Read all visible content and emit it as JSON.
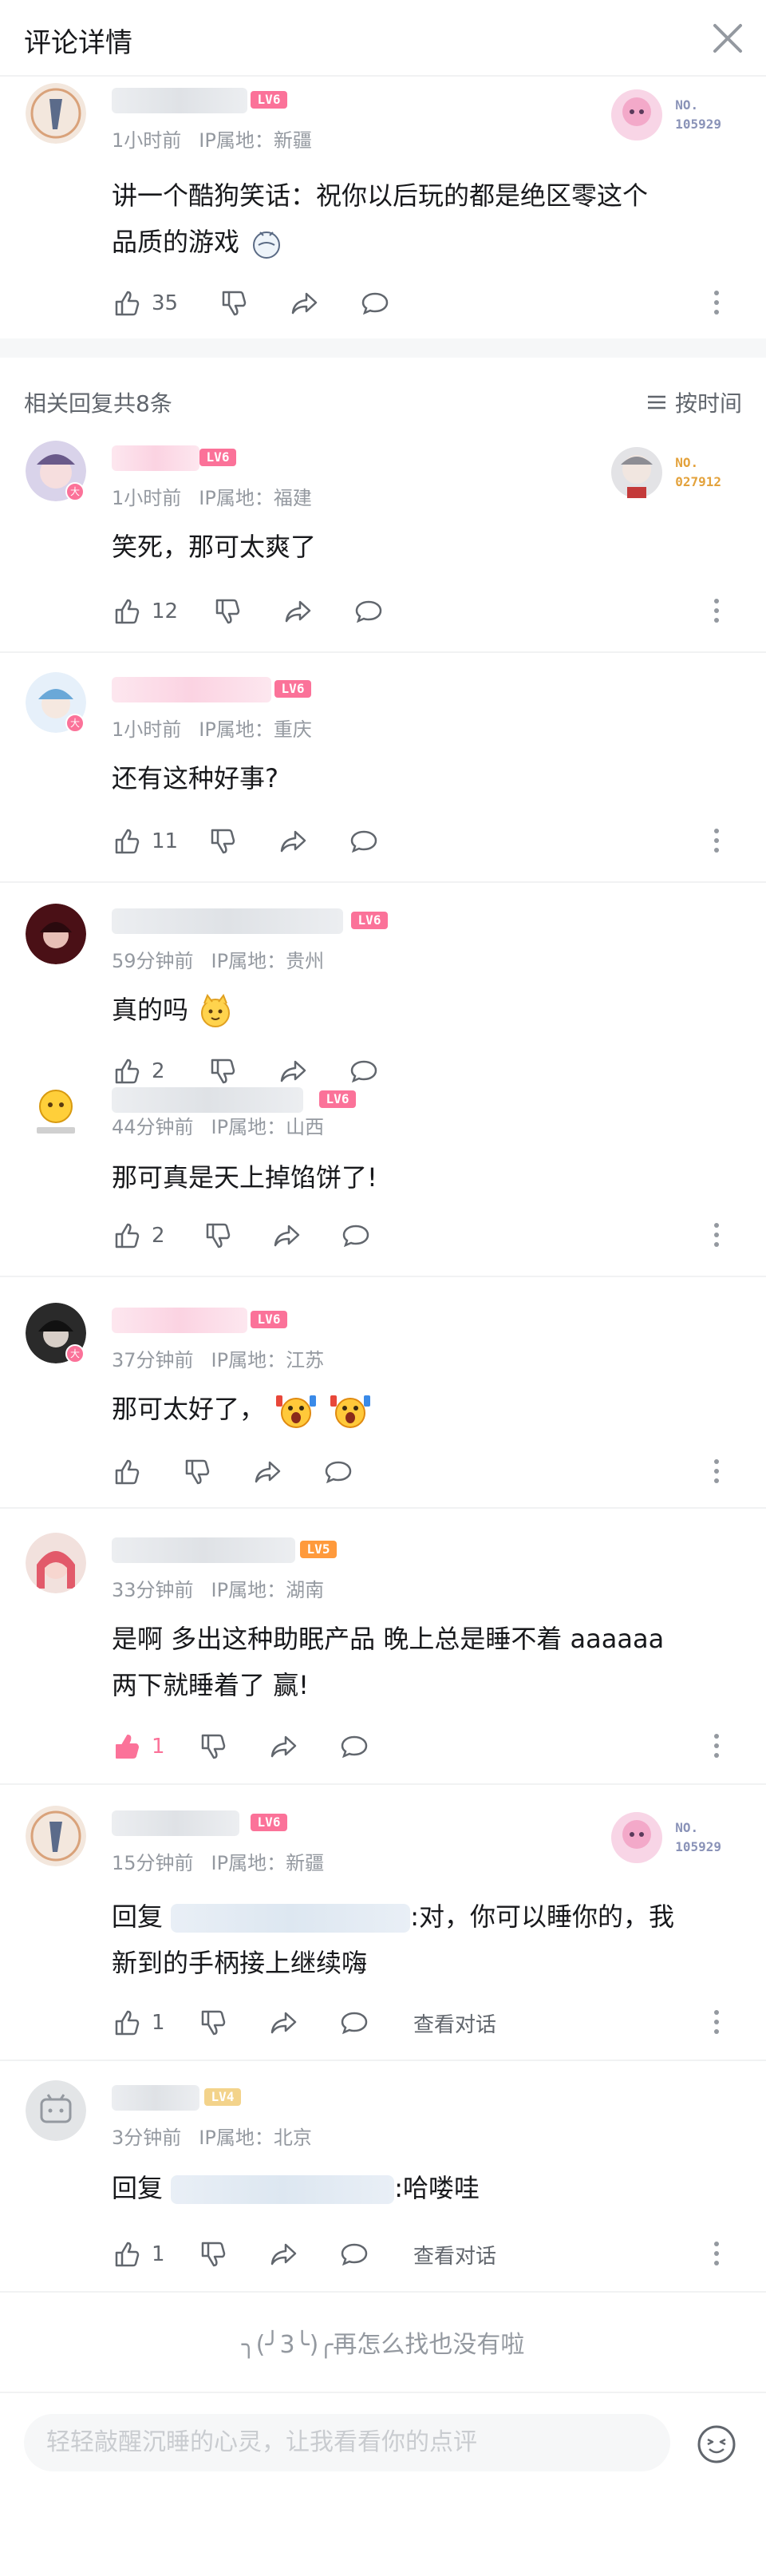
{
  "header": {
    "title": "评论详情"
  },
  "main_comment": {
    "level": "LV6",
    "time": "1小时前",
    "ip": "IP属地：新疆",
    "text_line1": "讲一个酷狗笑话：祝你以后玩的都是绝区零这个",
    "text_line2": "品质的游戏",
    "likes": "35",
    "fan_no_label": "NO.",
    "fan_no": "105929"
  },
  "replies_header": {
    "count_text": "相关回复共8条",
    "sort_label": "按时间"
  },
  "replies": [
    {
      "level": "LV6",
      "time": "1小时前",
      "ip": "IP属地：福建",
      "text": "笑死，那可太爽了",
      "likes": "12",
      "fan_no_label": "NO.",
      "fan_no": "027912"
    },
    {
      "level": "LV6",
      "time": "1小时前",
      "ip": "IP属地：重庆",
      "text": "还有这种好事?",
      "likes": "11"
    },
    {
      "level": "LV6",
      "time": "59分钟前",
      "ip": "IP属地：贵州",
      "text": "真的吗",
      "likes": "2"
    },
    {
      "level": "LV6",
      "time": "44分钟前",
      "ip": "IP属地：山西",
      "text": "那可真是天上掉馅饼了!",
      "likes": "2"
    },
    {
      "level": "LV6",
      "time": "37分钟前",
      "ip": "IP属地：江苏",
      "text": "那可太好了，",
      "likes": ""
    },
    {
      "level": "LV5",
      "time": "33分钟前",
      "ip": "IP属地：湖南",
      "text_line1": "是啊 多出这种助眠产品 晚上总是睡不着 aaaaaa",
      "text_line2": "两下就睡着了 赢!",
      "likes": "1"
    },
    {
      "level": "LV6",
      "time": "15分钟前",
      "ip": "IP属地：新疆",
      "reply_prefix": "回复",
      "text_suffix": ":对，你可以睡你的，我",
      "text_line2": "新到的手柄接上继续嗨",
      "likes": "1",
      "view_dialog": "查看对话",
      "fan_no_label": "NO.",
      "fan_no": "105929"
    },
    {
      "level": "LV4",
      "time": "3分钟前",
      "ip": "IP属地：北京",
      "reply_prefix": "回复",
      "text_suffix": ":哈喽哇",
      "likes": "1",
      "view_dialog": "查看对话"
    }
  ],
  "end_text": "╮(╯3╰)╭再怎么找也没有啦",
  "footer": {
    "input_placeholder": "轻轻敲醒沉睡的心灵，让我看看你的点评"
  },
  "colors": {
    "accent": "#fb7299",
    "text": "#18191c",
    "meta": "#9499a0"
  }
}
